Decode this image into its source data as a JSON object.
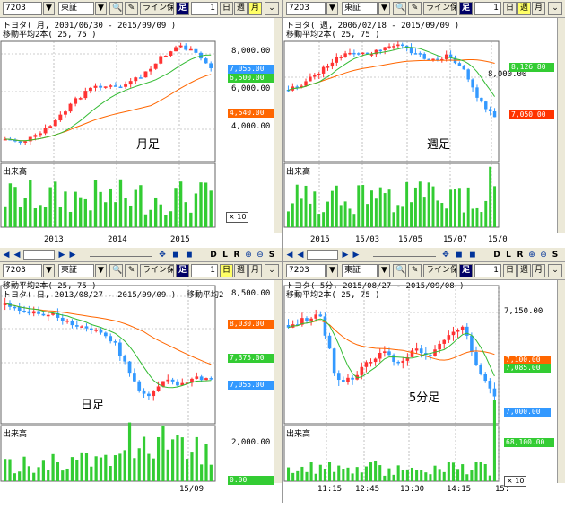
{
  "panels": {
    "monthly": {
      "toolbar": {
        "code": "7203",
        "exchange": "東証",
        "save": "ライン保存",
        "ashi": "足",
        "num": "1",
        "b_day": "日",
        "b_week": "週",
        "b_month": "月"
      },
      "title": "トヨタ( 月, 2001/06/30 - 2015/09/09 )",
      "ma_title": "移動平均2本( 25, 75 )",
      "big_label": "月足",
      "y_labels": [
        "8,000.00",
        "6,000.00",
        "4,000.00"
      ],
      "tags": [
        {
          "text": "7,055.00",
          "color": "#3399ff"
        },
        {
          "text": "6,500.00",
          "color": "#33cc33"
        },
        {
          "text": "4,540.00",
          "color": "#ff6600"
        }
      ],
      "vol_title": "出来高",
      "x10": "× 10",
      "x_labels": [
        "2013",
        "2014",
        "2015"
      ]
    },
    "weekly": {
      "toolbar": {
        "code": "7203",
        "exchange": "東証",
        "save": "ライン保存",
        "ashi": "足",
        "num": "1",
        "b_day": "日",
        "b_week": "週",
        "b_month": "月"
      },
      "title": "トヨタ( 週, 2006/02/18 - 2015/09/09 )",
      "ma_title": "移動平均2本( 25, 75 )",
      "big_label": "週足",
      "y_labels": [
        "8,000.00"
      ],
      "tags": [
        {
          "text": "8,126.80",
          "color": "#33cc33"
        },
        {
          "text": "7,050.00",
          "color": "#ff3300"
        }
      ],
      "vol_title": "出来高",
      "x_labels": [
        "2015",
        "15/03",
        "15/05",
        "15/07",
        "15/0"
      ]
    },
    "daily": {
      "scroll": {
        "d": "D",
        "l": "L",
        "r": "R",
        "s": "S"
      },
      "toolbar": {
        "code": "7203",
        "exchange": "東証",
        "save": "ライン保存",
        "ashi": "足",
        "num": "1",
        "b_day": "日",
        "b_week": "週",
        "b_month": "月"
      },
      "title": "トヨタ( 日, 2013/08/27 - 2015/09/09 )",
      "ma_title": "移動平均2本( 25, 75 )",
      "ma_title2": "移動平均2",
      "big_label": "日足",
      "y_labels": [
        "8,500.00",
        "8,000.00",
        "7,500.00"
      ],
      "tags": [
        {
          "text": "8,030.00",
          "color": "#ff6600"
        },
        {
          "text": "7,375.00",
          "color": "#33cc33"
        },
        {
          "text": "7,055.00",
          "color": "#3399ff"
        }
      ],
      "vol_title": "出来高",
      "vol_labels": [
        "2,000.00",
        "0.00"
      ],
      "x_labels": [
        "15/09"
      ]
    },
    "min5": {
      "scroll": {
        "d": "D",
        "l": "L",
        "r": "R",
        "s": "S"
      },
      "toolbar": {
        "code": "7203",
        "exchange": "東証",
        "save": "ライン保存",
        "ashi": "足",
        "num": "1",
        "b_day": "日",
        "b_week": "週",
        "b_month": "月"
      },
      "title": "トヨタ( 5分, 2015/08/27 - 2015/09/08 )",
      "ma_title": "移動平均2本( 25, 75 )",
      "big_label": "5分足",
      "y_labels": [
        "7,150.00"
      ],
      "tags": [
        {
          "text": "7,100.00",
          "color": "#ff6600"
        },
        {
          "text": "7,085.00",
          "color": "#33cc33"
        },
        {
          "text": "7,000.00",
          "color": "#3399ff"
        }
      ],
      "vol_title": "出来高",
      "vol_labels": [
        "68,100.00"
      ],
      "x10": "× 10",
      "x_labels": [
        "11:15",
        "12:45",
        "13:30",
        "14:15",
        "15:"
      ]
    }
  },
  "colors": {
    "up": "#ff3333",
    "down": "#3399ff",
    "ma_short": "#33bb33",
    "ma_long": "#ff6600",
    "volume": "#33cc33",
    "grid": "#999999"
  }
}
